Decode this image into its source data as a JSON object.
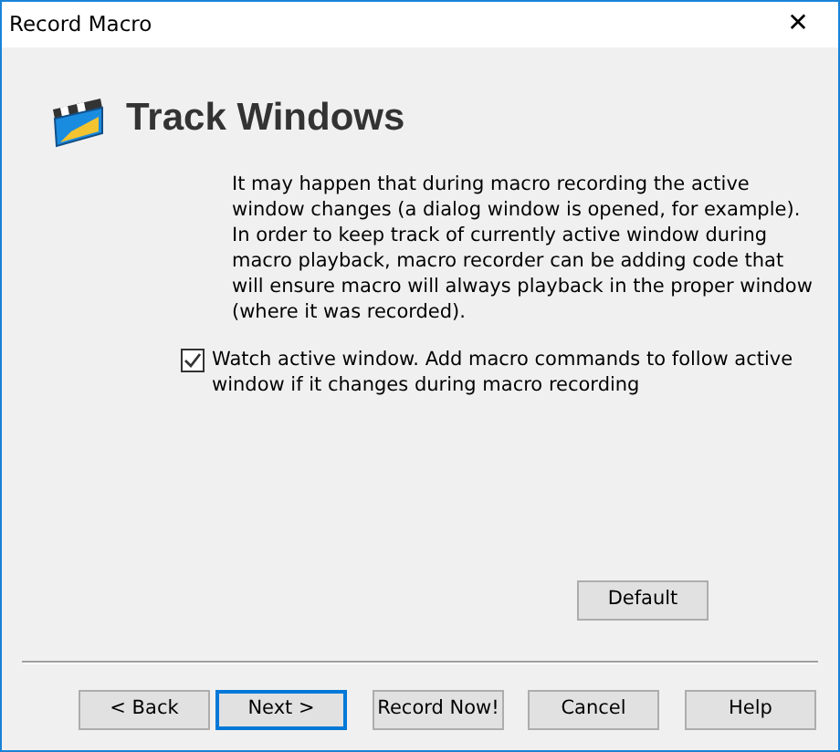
{
  "window": {
    "title": "Record Macro",
    "close": "✕"
  },
  "header": {
    "title": "Track Windows"
  },
  "description": [
    "It may happen that during macro recording the active window changes (a dialog window is opened, for example).",
    "In order to keep track of currently active window during macro playback, macro recorder can be adding code that will ensure macro will always playback in the proper window (where it was recorded)."
  ],
  "option": {
    "label": "Watch active window. Add macro commands to follow active window if it changes during macro recording",
    "checked": true
  },
  "default_button": "Default",
  "buttons": [
    {
      "label": "< Back",
      "focused": false
    },
    {
      "label": "Next >",
      "focused": true
    },
    {
      "label": "Record Now!",
      "focused": false
    },
    {
      "label": "Cancel",
      "focused": false
    },
    {
      "label": "Help",
      "focused": false
    }
  ]
}
